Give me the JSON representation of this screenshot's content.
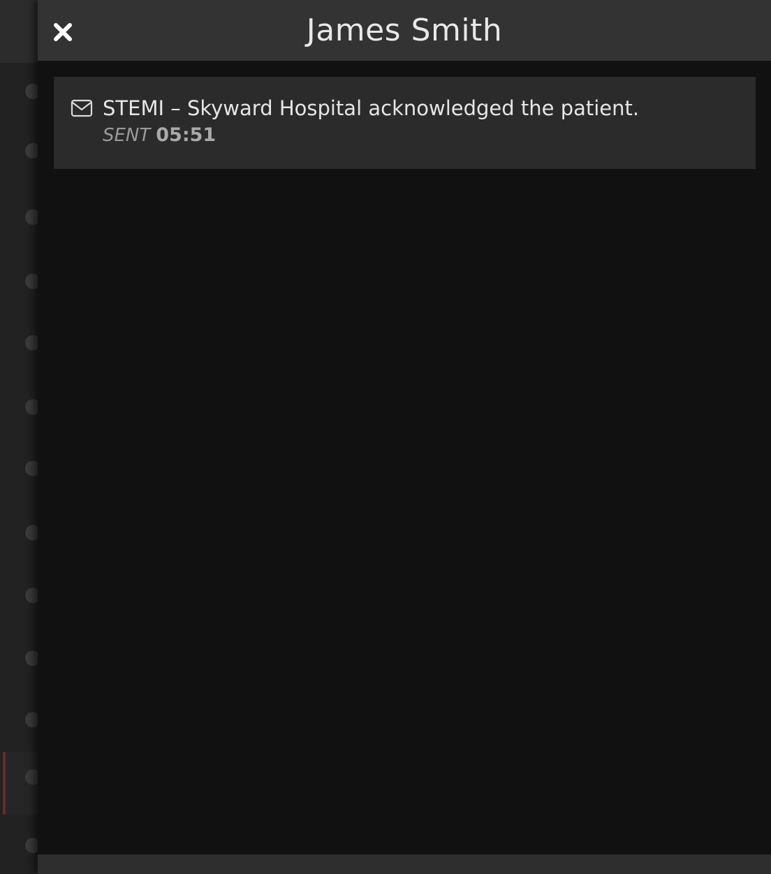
{
  "panel": {
    "title": "James Smith",
    "close_icon": "close-icon"
  },
  "messages": [
    {
      "icon": "mail-icon",
      "text": "STEMI – Skyward Hospital acknowledged the patient.",
      "status_label": "SENT",
      "time": "05:51"
    }
  ],
  "colors": {
    "header_bg": "#333333",
    "panel_bg": "#111111",
    "card_bg": "#2b2b2b",
    "text": "#e6e6e6",
    "muted": "#9a9a9a"
  }
}
